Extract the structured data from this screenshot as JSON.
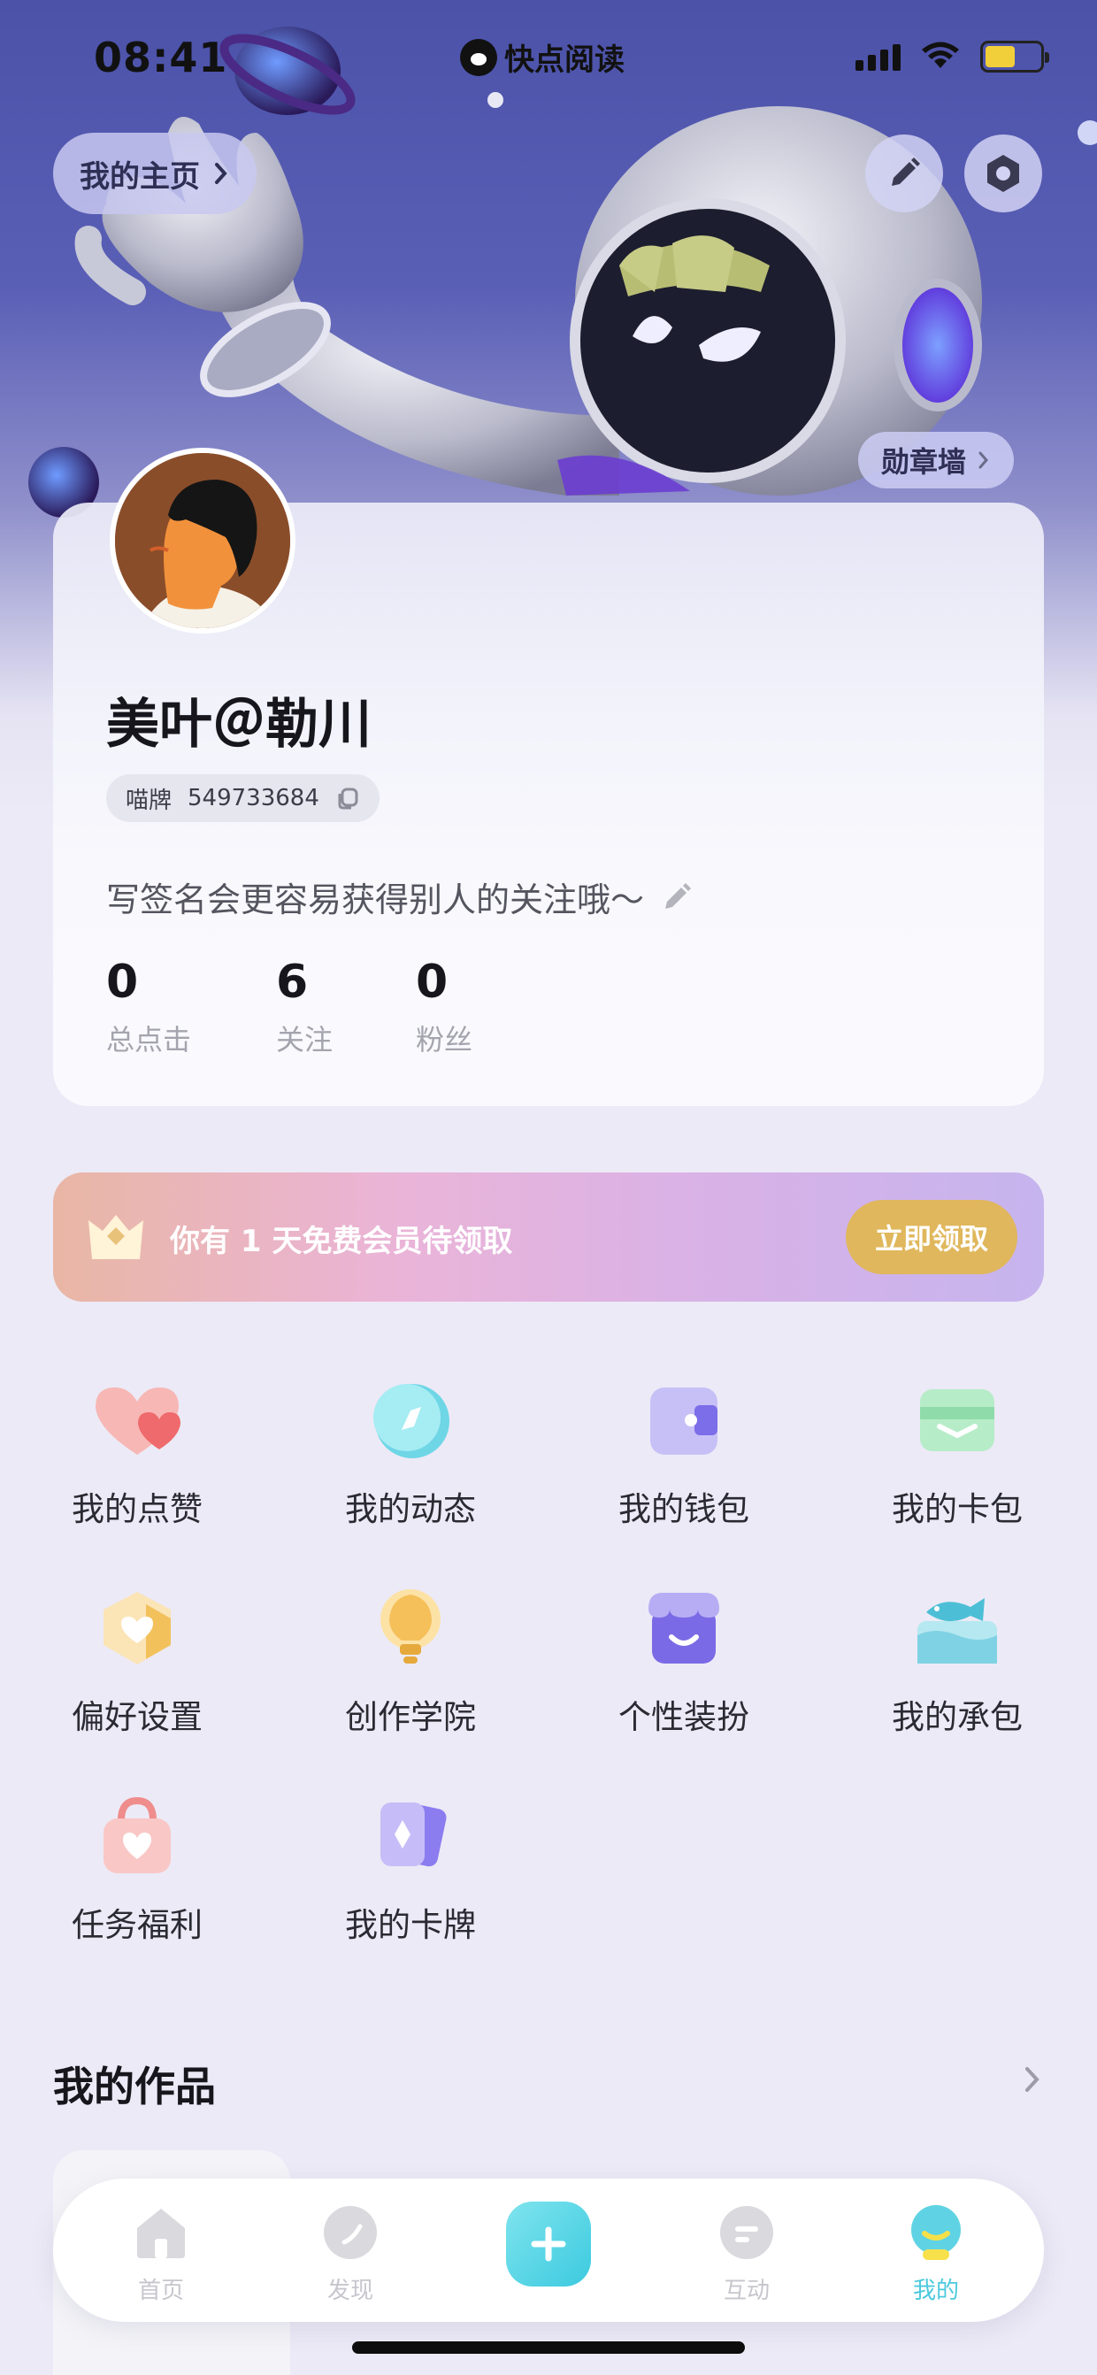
{
  "status_bar": {
    "time": "08:41",
    "app_name": "快点阅读",
    "battery_level": 0.55
  },
  "header": {
    "home_label": "我的主页",
    "medal_wall_label": "勋章墙"
  },
  "profile": {
    "name": "美叶＠勒川",
    "id_prefix": "喵牌",
    "id_number": "549733684",
    "bio_placeholder": "写签名会更容易获得别人的关注哦～",
    "stats": [
      {
        "value": "0",
        "label": "总点击"
      },
      {
        "value": "6",
        "label": "关注"
      },
      {
        "value": "0",
        "label": "粉丝"
      }
    ]
  },
  "vip_banner": {
    "text": "你有 1 天免费会员待领取",
    "button": "立即领取"
  },
  "menu": [
    {
      "label": "我的点赞",
      "icon": "heart-icon"
    },
    {
      "label": "我的动态",
      "icon": "compass-icon"
    },
    {
      "label": "我的钱包",
      "icon": "wallet-icon"
    },
    {
      "label": "我的卡包",
      "icon": "card-holder-icon"
    },
    {
      "label": "偏好设置",
      "icon": "preference-icon"
    },
    {
      "label": "创作学院",
      "icon": "lightbulb-icon"
    },
    {
      "label": "个性装扮",
      "icon": "shop-icon"
    },
    {
      "label": "我的承包",
      "icon": "fish-icon"
    },
    {
      "label": "任务福利",
      "icon": "gift-bag-icon"
    },
    {
      "label": "我的卡牌",
      "icon": "cards-icon"
    }
  ],
  "works": {
    "title": "我的作品"
  },
  "tabbar": {
    "tabs": [
      {
        "label": "首页",
        "icon": "home-icon"
      },
      {
        "label": "发现",
        "icon": "discover-icon"
      },
      {
        "label": "互动",
        "icon": "chat-icon"
      },
      {
        "label": "我的",
        "icon": "profile-icon"
      }
    ],
    "active": "我的"
  },
  "colors": {
    "accent": "#4bc9dd",
    "vip_button": "#e0b75c",
    "hero_bg": "#4b52a8"
  }
}
